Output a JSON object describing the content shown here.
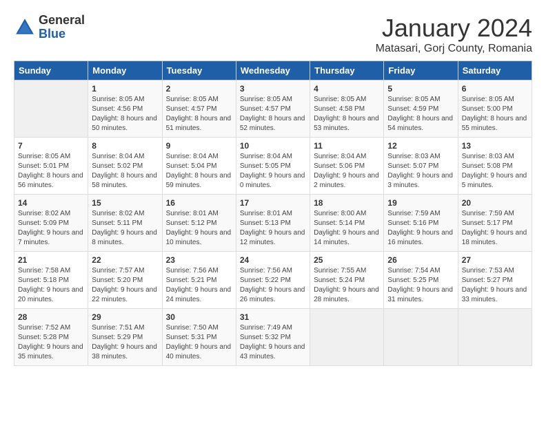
{
  "logo": {
    "general": "General",
    "blue": "Blue"
  },
  "title": "January 2024",
  "location": "Matasari, Gorj County, Romania",
  "weekdays": [
    "Sunday",
    "Monday",
    "Tuesday",
    "Wednesday",
    "Thursday",
    "Friday",
    "Saturday"
  ],
  "weeks": [
    [
      {
        "day": "",
        "sunrise": "",
        "sunset": "",
        "daylight": ""
      },
      {
        "day": "1",
        "sunrise": "Sunrise: 8:05 AM",
        "sunset": "Sunset: 4:56 PM",
        "daylight": "Daylight: 8 hours and 50 minutes."
      },
      {
        "day": "2",
        "sunrise": "Sunrise: 8:05 AM",
        "sunset": "Sunset: 4:57 PM",
        "daylight": "Daylight: 8 hours and 51 minutes."
      },
      {
        "day": "3",
        "sunrise": "Sunrise: 8:05 AM",
        "sunset": "Sunset: 4:57 PM",
        "daylight": "Daylight: 8 hours and 52 minutes."
      },
      {
        "day": "4",
        "sunrise": "Sunrise: 8:05 AM",
        "sunset": "Sunset: 4:58 PM",
        "daylight": "Daylight: 8 hours and 53 minutes."
      },
      {
        "day": "5",
        "sunrise": "Sunrise: 8:05 AM",
        "sunset": "Sunset: 4:59 PM",
        "daylight": "Daylight: 8 hours and 54 minutes."
      },
      {
        "day": "6",
        "sunrise": "Sunrise: 8:05 AM",
        "sunset": "Sunset: 5:00 PM",
        "daylight": "Daylight: 8 hours and 55 minutes."
      }
    ],
    [
      {
        "day": "7",
        "sunrise": "Sunrise: 8:05 AM",
        "sunset": "Sunset: 5:01 PM",
        "daylight": "Daylight: 8 hours and 56 minutes."
      },
      {
        "day": "8",
        "sunrise": "Sunrise: 8:04 AM",
        "sunset": "Sunset: 5:02 PM",
        "daylight": "Daylight: 8 hours and 58 minutes."
      },
      {
        "day": "9",
        "sunrise": "Sunrise: 8:04 AM",
        "sunset": "Sunset: 5:04 PM",
        "daylight": "Daylight: 8 hours and 59 minutes."
      },
      {
        "day": "10",
        "sunrise": "Sunrise: 8:04 AM",
        "sunset": "Sunset: 5:05 PM",
        "daylight": "Daylight: 9 hours and 0 minutes."
      },
      {
        "day": "11",
        "sunrise": "Sunrise: 8:04 AM",
        "sunset": "Sunset: 5:06 PM",
        "daylight": "Daylight: 9 hours and 2 minutes."
      },
      {
        "day": "12",
        "sunrise": "Sunrise: 8:03 AM",
        "sunset": "Sunset: 5:07 PM",
        "daylight": "Daylight: 9 hours and 3 minutes."
      },
      {
        "day": "13",
        "sunrise": "Sunrise: 8:03 AM",
        "sunset": "Sunset: 5:08 PM",
        "daylight": "Daylight: 9 hours and 5 minutes."
      }
    ],
    [
      {
        "day": "14",
        "sunrise": "Sunrise: 8:02 AM",
        "sunset": "Sunset: 5:09 PM",
        "daylight": "Daylight: 9 hours and 7 minutes."
      },
      {
        "day": "15",
        "sunrise": "Sunrise: 8:02 AM",
        "sunset": "Sunset: 5:11 PM",
        "daylight": "Daylight: 9 hours and 8 minutes."
      },
      {
        "day": "16",
        "sunrise": "Sunrise: 8:01 AM",
        "sunset": "Sunset: 5:12 PM",
        "daylight": "Daylight: 9 hours and 10 minutes."
      },
      {
        "day": "17",
        "sunrise": "Sunrise: 8:01 AM",
        "sunset": "Sunset: 5:13 PM",
        "daylight": "Daylight: 9 hours and 12 minutes."
      },
      {
        "day": "18",
        "sunrise": "Sunrise: 8:00 AM",
        "sunset": "Sunset: 5:14 PM",
        "daylight": "Daylight: 9 hours and 14 minutes."
      },
      {
        "day": "19",
        "sunrise": "Sunrise: 7:59 AM",
        "sunset": "Sunset: 5:16 PM",
        "daylight": "Daylight: 9 hours and 16 minutes."
      },
      {
        "day": "20",
        "sunrise": "Sunrise: 7:59 AM",
        "sunset": "Sunset: 5:17 PM",
        "daylight": "Daylight: 9 hours and 18 minutes."
      }
    ],
    [
      {
        "day": "21",
        "sunrise": "Sunrise: 7:58 AM",
        "sunset": "Sunset: 5:18 PM",
        "daylight": "Daylight: 9 hours and 20 minutes."
      },
      {
        "day": "22",
        "sunrise": "Sunrise: 7:57 AM",
        "sunset": "Sunset: 5:20 PM",
        "daylight": "Daylight: 9 hours and 22 minutes."
      },
      {
        "day": "23",
        "sunrise": "Sunrise: 7:56 AM",
        "sunset": "Sunset: 5:21 PM",
        "daylight": "Daylight: 9 hours and 24 minutes."
      },
      {
        "day": "24",
        "sunrise": "Sunrise: 7:56 AM",
        "sunset": "Sunset: 5:22 PM",
        "daylight": "Daylight: 9 hours and 26 minutes."
      },
      {
        "day": "25",
        "sunrise": "Sunrise: 7:55 AM",
        "sunset": "Sunset: 5:24 PM",
        "daylight": "Daylight: 9 hours and 28 minutes."
      },
      {
        "day": "26",
        "sunrise": "Sunrise: 7:54 AM",
        "sunset": "Sunset: 5:25 PM",
        "daylight": "Daylight: 9 hours and 31 minutes."
      },
      {
        "day": "27",
        "sunrise": "Sunrise: 7:53 AM",
        "sunset": "Sunset: 5:27 PM",
        "daylight": "Daylight: 9 hours and 33 minutes."
      }
    ],
    [
      {
        "day": "28",
        "sunrise": "Sunrise: 7:52 AM",
        "sunset": "Sunset: 5:28 PM",
        "daylight": "Daylight: 9 hours and 35 minutes."
      },
      {
        "day": "29",
        "sunrise": "Sunrise: 7:51 AM",
        "sunset": "Sunset: 5:29 PM",
        "daylight": "Daylight: 9 hours and 38 minutes."
      },
      {
        "day": "30",
        "sunrise": "Sunrise: 7:50 AM",
        "sunset": "Sunset: 5:31 PM",
        "daylight": "Daylight: 9 hours and 40 minutes."
      },
      {
        "day": "31",
        "sunrise": "Sunrise: 7:49 AM",
        "sunset": "Sunset: 5:32 PM",
        "daylight": "Daylight: 9 hours and 43 minutes."
      },
      {
        "day": "",
        "sunrise": "",
        "sunset": "",
        "daylight": ""
      },
      {
        "day": "",
        "sunrise": "",
        "sunset": "",
        "daylight": ""
      },
      {
        "day": "",
        "sunrise": "",
        "sunset": "",
        "daylight": ""
      }
    ]
  ]
}
